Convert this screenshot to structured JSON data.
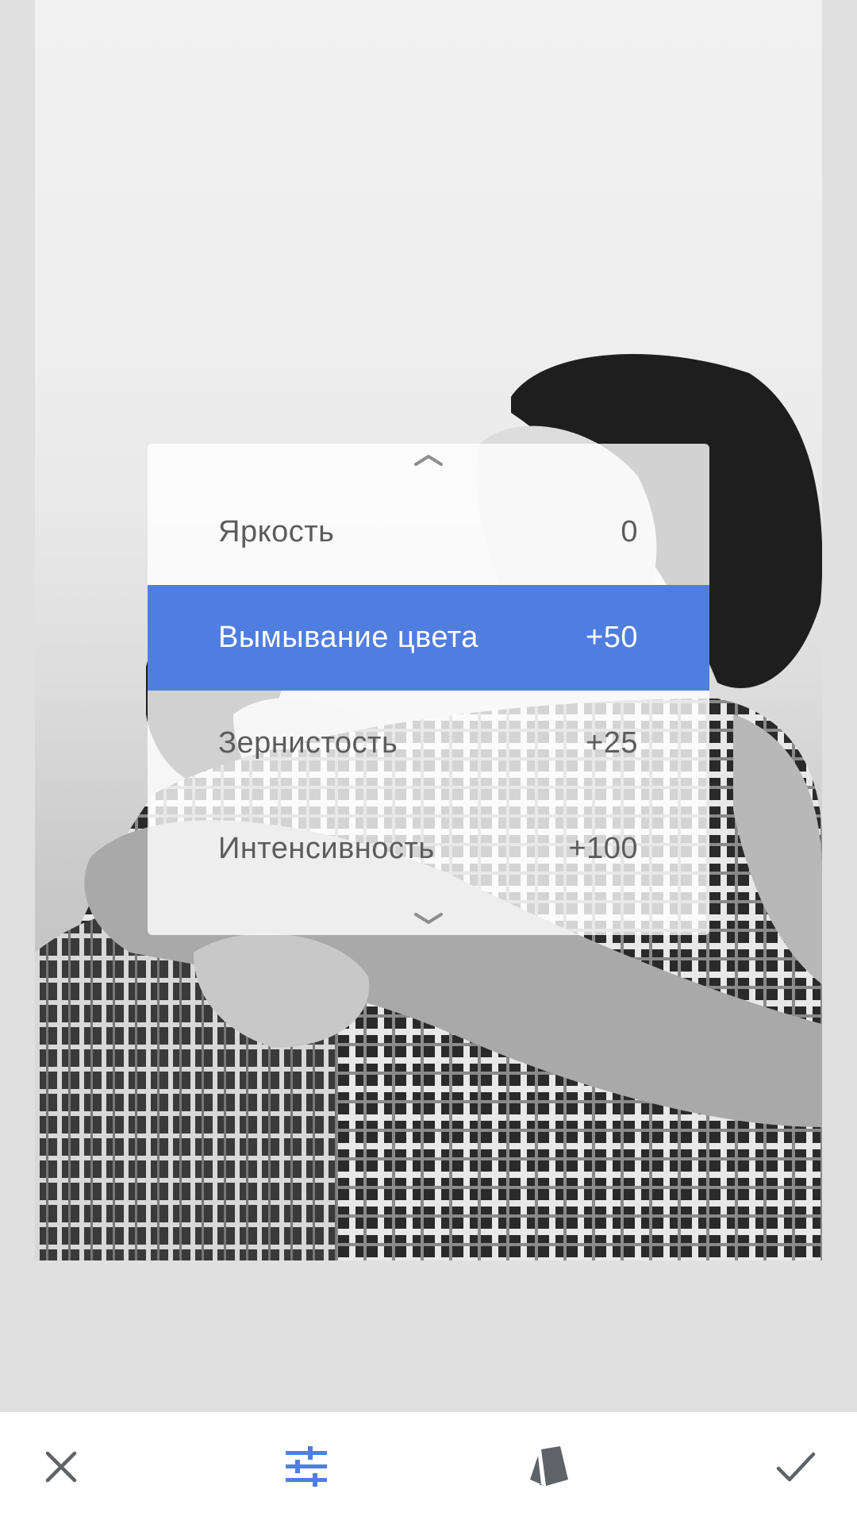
{
  "panel": {
    "items": [
      {
        "label": "Яркость",
        "value": "0",
        "selected": false
      },
      {
        "label": "Вымывание цвета",
        "value": "+50",
        "selected": true
      },
      {
        "label": "Зернистость",
        "value": "+25",
        "selected": false
      },
      {
        "label": "Интенсивность",
        "value": "+100",
        "selected": false
      }
    ]
  },
  "bottom_bar": {
    "icons": [
      "close-icon",
      "tune-icon",
      "styles-icon",
      "checkmark-icon"
    ]
  },
  "colors": {
    "accent": "#507de0",
    "icon_gray": "#5f6368",
    "background": "#e0e0e0"
  }
}
